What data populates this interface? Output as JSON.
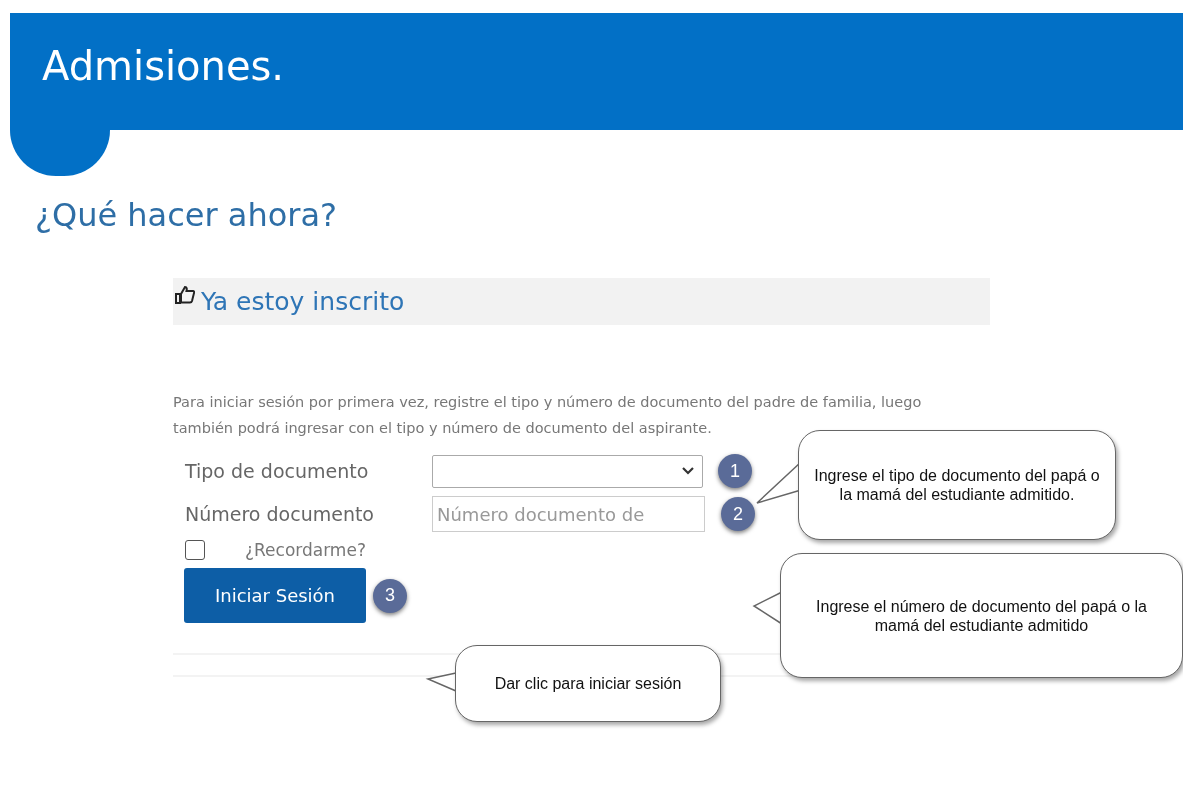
{
  "header": {
    "title": "Admisiones."
  },
  "heading": "¿Qué hacer ahora?",
  "section": {
    "title": "Ya estoy inscrito",
    "description": "Para iniciar sesión por primera vez, registre el tipo y número de documento del padre de familia, luego también podrá ingresar con el tipo y número de documento del aspirante."
  },
  "form": {
    "fields": [
      {
        "kind": "select",
        "label": "Tipo de documento",
        "step": "1"
      },
      {
        "kind": "text",
        "label": "Número documento",
        "placeholder": "Número documento de",
        "step": "2"
      }
    ],
    "remember": {
      "label": "¿Recordarme?",
      "checked": false
    },
    "submit": {
      "label": "Iniciar Sesión",
      "step": "3"
    }
  },
  "callouts": [
    {
      "text": "Ingrese el tipo de documento del papá o la mamá del estudiante admitido."
    },
    {
      "text": "Ingrese el número de documento del papá o la mamá del estudiante admitido"
    },
    {
      "text": "Dar clic para iniciar sesión"
    }
  ]
}
